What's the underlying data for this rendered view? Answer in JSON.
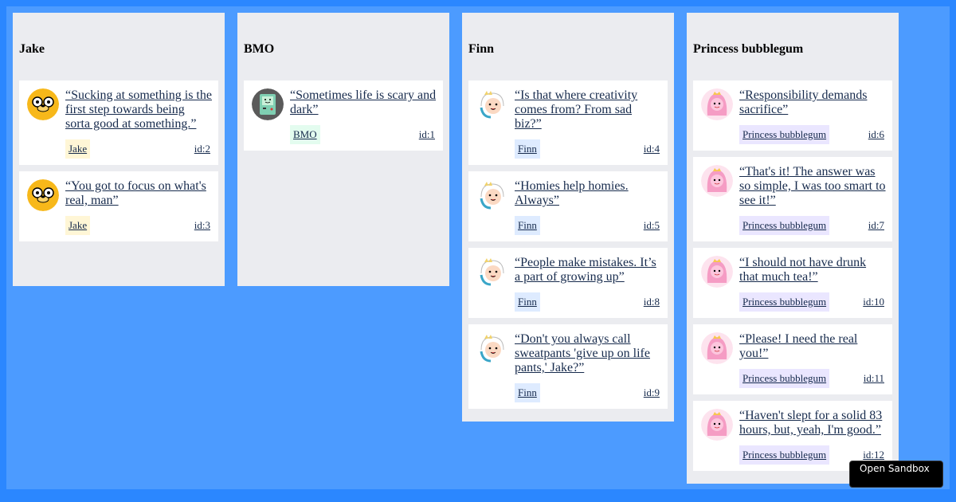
{
  "columns": [
    {
      "title": "Jake",
      "cards": [
        {
          "quote": "“Sucking at something is the first step towards being sorta good at something.”",
          "author": "Jake",
          "id": "id:2"
        },
        {
          "quote": "“You got to focus on what's real, man”",
          "author": "Jake",
          "id": "id:3"
        }
      ]
    },
    {
      "title": "BMO",
      "cards": [
        {
          "quote": "“Sometimes life is scary and dark”",
          "author": "BMO",
          "id": "id:1"
        }
      ]
    },
    {
      "title": "Finn",
      "cards": [
        {
          "quote": "“Is that where creativity comes from? From sad biz?”",
          "author": "Finn",
          "id": "id:4"
        },
        {
          "quote": "“Homies help homies. Always”",
          "author": "Finn",
          "id": "id:5"
        },
        {
          "quote": "“People make mistakes. It’s a part of growing up”",
          "author": "Finn",
          "id": "id:8"
        },
        {
          "quote": "“Don't you always call sweatpants 'give up on life pants,' Jake?”",
          "author": "Finn",
          "id": "id:9"
        }
      ]
    },
    {
      "title": "Princess bubblegum",
      "cards": [
        {
          "quote": "“Responsibility demands sacrifice”",
          "author": "Princess bubblegum",
          "id": "id:6"
        },
        {
          "quote": "“That's it! The answer was so simple, I was too smart to see it!”",
          "author": "Princess bubblegum",
          "id": "id:7"
        },
        {
          "quote": "“I should not have drunk that much tea!”",
          "author": "Princess bubblegum",
          "id": "id:10"
        },
        {
          "quote": "“Please! I need the real you!”",
          "author": "Princess bubblegum",
          "id": "id:11"
        },
        {
          "quote": "“Haven't slept for a solid 83 hours, but, yeah, I'm good.”",
          "author": "Princess bubblegum",
          "id": "id:12"
        }
      ]
    }
  ],
  "sandbox_button": {
    "label": "Open Sandbox"
  },
  "colors": {
    "background": "#2b87ff",
    "board": "#4c9bff",
    "column": "#ebecf0",
    "jake_tag": "#fff6d6",
    "bmo_tag": "#e3fcef",
    "finn_tag": "#deebff",
    "pb_tag": "#eae6ff"
  },
  "icons": {
    "jake": "jake-avatar-icon",
    "bmo": "bmo-avatar-icon",
    "finn": "finn-avatar-icon",
    "pb": "princess-bubblegum-avatar-icon"
  }
}
